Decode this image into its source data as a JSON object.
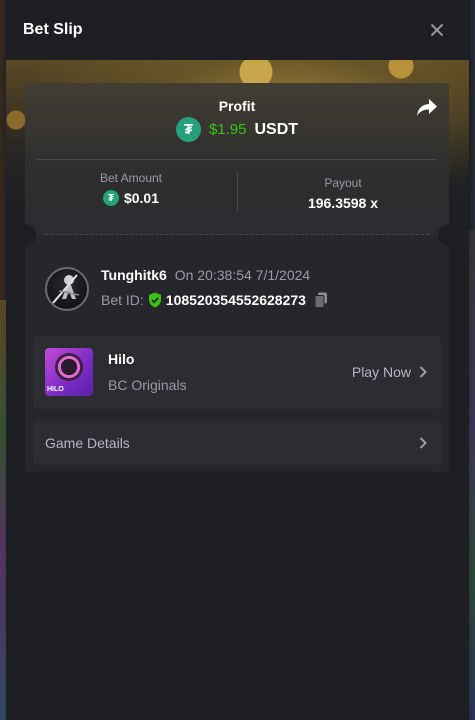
{
  "modal": {
    "title": "Bet Slip"
  },
  "profit": {
    "label": "Profit",
    "value": "$1.95",
    "currency": "USDT",
    "currency_icon": "tether-icon"
  },
  "bet_amount": {
    "label": "Bet Amount",
    "value": "$0.01"
  },
  "payout": {
    "label": "Payout",
    "value": "196.3598 x"
  },
  "user": {
    "name": "Tunghitk6",
    "time": "On 20:38:54 7/1/2024",
    "bet_id_label": "Bet ID:",
    "bet_id": "108520354552628273"
  },
  "game": {
    "name": "Hilo",
    "provider": "BC Originals",
    "thumb_text": "HILO",
    "play_label": "Play Now"
  },
  "details": {
    "label": "Game Details"
  },
  "colors": {
    "profit_green": "#3bc117",
    "usdt_teal": "#26a17b",
    "background": "#1e1f23",
    "card": "#26272c"
  }
}
